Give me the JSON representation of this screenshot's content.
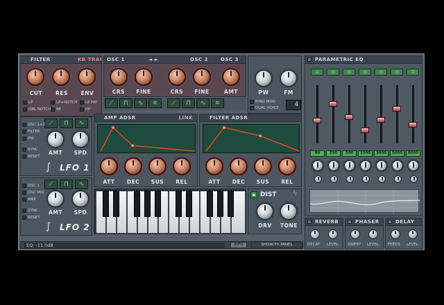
{
  "filter": {
    "title": "FILTER",
    "kb_track": "KB TRACK",
    "knobs": [
      "CUT",
      "RES",
      "ENV"
    ],
    "modes": [
      "LP",
      "LP+NOTCH",
      "LP FAT",
      "DBL NOTCH",
      "BP",
      "HP"
    ]
  },
  "osc": {
    "tab1": "OSC 1",
    "tab2": "OSC 2",
    "tab3": "OSC 3",
    "arrows": "◄ ►",
    "knobs": [
      "CRS",
      "FINE",
      "CRS",
      "FINE",
      "AMT"
    ],
    "pw": "PW",
    "fm": "FM",
    "ring_mod": "RING MOD",
    "dual_voice": "DUAL VOICE",
    "voice_count": "4"
  },
  "lfo1": {
    "targets": [
      "OSC 1+2",
      "FILTER",
      "PW"
    ],
    "sync": "SYNC",
    "reset": "RESET",
    "knobs": [
      "AMT",
      "SPD"
    ],
    "label": "LFO 1"
  },
  "lfo2": {
    "targets": [
      "OSC 1",
      "OSC MIX",
      "AMP"
    ],
    "sync": "SYNC",
    "reset": "RESET",
    "knobs": [
      "AMT",
      "SPD"
    ],
    "label": "LFO 2"
  },
  "amp_adsr": {
    "title": "AMP ADSR",
    "link": "LINK",
    "knobs": [
      "ATT",
      "DEC",
      "SUS",
      "REL"
    ]
  },
  "filter_adsr": {
    "title": "FILTER ADSR",
    "knobs": [
      "ATT",
      "DEC",
      "SUS",
      "REL"
    ]
  },
  "dist": {
    "title": "DIST",
    "knobs": [
      "DRV",
      "TONE"
    ]
  },
  "eq": {
    "title": "PARAMETRIC EQ",
    "bands": [
      "90",
      "250",
      "500",
      "1500",
      "3000",
      "5000",
      "8000"
    ],
    "slider_levels": [
      0.38,
      0.7,
      0.45,
      0.2,
      0.4,
      0.6,
      0.3
    ]
  },
  "fx": [
    {
      "title": "REVERB",
      "knobs": [
        "DECAY",
        "LEVEL"
      ]
    },
    {
      "title": "PHASER",
      "knobs": [
        "SWEEP",
        "LEVEL"
      ]
    },
    {
      "title": "DELAY",
      "knobs": [
        "FEEDS",
        "LEVEL"
      ]
    }
  ],
  "status": {
    "text": "EQ: -11.0dB",
    "info": "INFO",
    "show_fx": "SHOW FX PANEL"
  },
  "colors": {
    "accent_green": "#4fae5c",
    "knob_copper": "#d38d70",
    "envelope_line": "#d64a2a"
  }
}
